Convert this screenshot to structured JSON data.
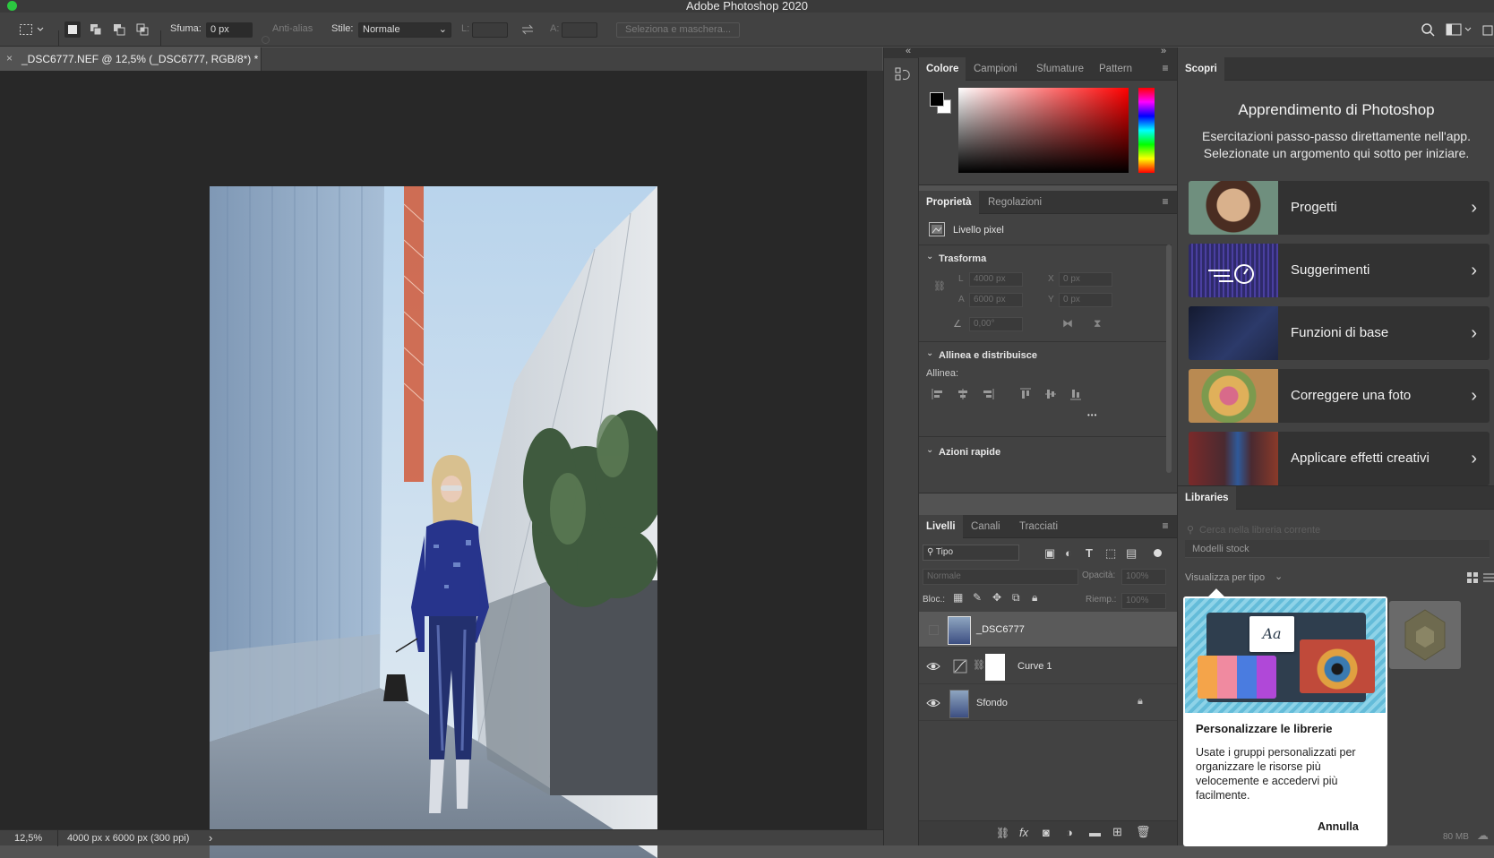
{
  "app": {
    "title": "Adobe Photoshop 2020"
  },
  "options_bar": {
    "feather_label": "Sfuma:",
    "feather_value": "0 px",
    "antialias_label": "Anti-alias",
    "style_label": "Stile:",
    "style_value": "Normale",
    "width_label": "L:",
    "height_label": "A:",
    "select_mask_label": "Seleziona e maschera..."
  },
  "document": {
    "tab_title": "_DSC6777.NEF @ 12,5% (_DSC6777, RGB/8*) *",
    "close_glyph": "×"
  },
  "status_bar": {
    "zoom": "12,5%",
    "doc_info": "4000 px x 6000 px (300 ppi)",
    "arrow": "›"
  },
  "color_panel": {
    "tabs": [
      "Colore",
      "Campioni",
      "Sfumature",
      "Pattern"
    ],
    "active_tab": 0,
    "hue_color": "#ff0000"
  },
  "properties_panel": {
    "tabs": [
      "Proprietà",
      "Regolazioni"
    ],
    "layer_type": "Livello pixel",
    "transform_title": "Trasforma",
    "w_label": "L",
    "w_value": "4000 px",
    "h_label": "A",
    "h_value": "6000 px",
    "x_label": "X",
    "x_value": "0 px",
    "y_label": "Y",
    "y_value": "0 px",
    "angle_value": "0,00°",
    "align_title": "Allinea e distribuisce",
    "align_label": "Allinea:",
    "more_glyph": "•••",
    "quick_actions_title": "Azioni rapide"
  },
  "layers_panel": {
    "tabs": [
      "Livelli",
      "Canali",
      "Tracciati"
    ],
    "filter_value": "Tipo",
    "blend_mode": "Normale",
    "opacity_label": "Opacità:",
    "opacity_value": "100%",
    "lock_label": "Bloc.:",
    "fill_label": "Riemp.:",
    "fill_value": "100%",
    "layers": [
      {
        "name": "_DSC6777",
        "visible": false,
        "selected": true
      },
      {
        "name": "Curve 1",
        "visible": true,
        "selected": false
      },
      {
        "name": "Sfondo",
        "visible": true,
        "selected": false
      }
    ],
    "bottom_fx": "fx"
  },
  "discover_panel": {
    "tab": "Scopri",
    "heading": "Apprendimento di Photoshop",
    "subheading": "Esercitazioni passo-passo direttamente nell'app. Selezionate un argomento qui sotto per iniziare.",
    "cards": [
      {
        "label": "Progetti",
        "thumb_color": "#6f8f7e"
      },
      {
        "label": "Suggerimenti",
        "thumb_color": "#2e2a6a"
      },
      {
        "label": "Funzioni di base",
        "thumb_color": "#1f2745"
      },
      {
        "label": "Correggere una foto",
        "thumb_color": "#b98a52"
      },
      {
        "label": "Applicare effetti creativi",
        "thumb_color": "#4a2a30"
      }
    ]
  },
  "libraries_panel": {
    "tab": "Libraries",
    "search_placeholder": "Cerca nella libreria corrente",
    "stock_models": "Modelli stock",
    "view_by_type": "Visualizza per tipo",
    "storage": "80 MB",
    "popup": {
      "title": "Personalizzare le librerie",
      "body": "Usate i gruppi personalizzati per organizzare le risorse più velocemente e accedervi più facilmente.",
      "cancel": "Annulla",
      "art_text": "Aa"
    }
  }
}
